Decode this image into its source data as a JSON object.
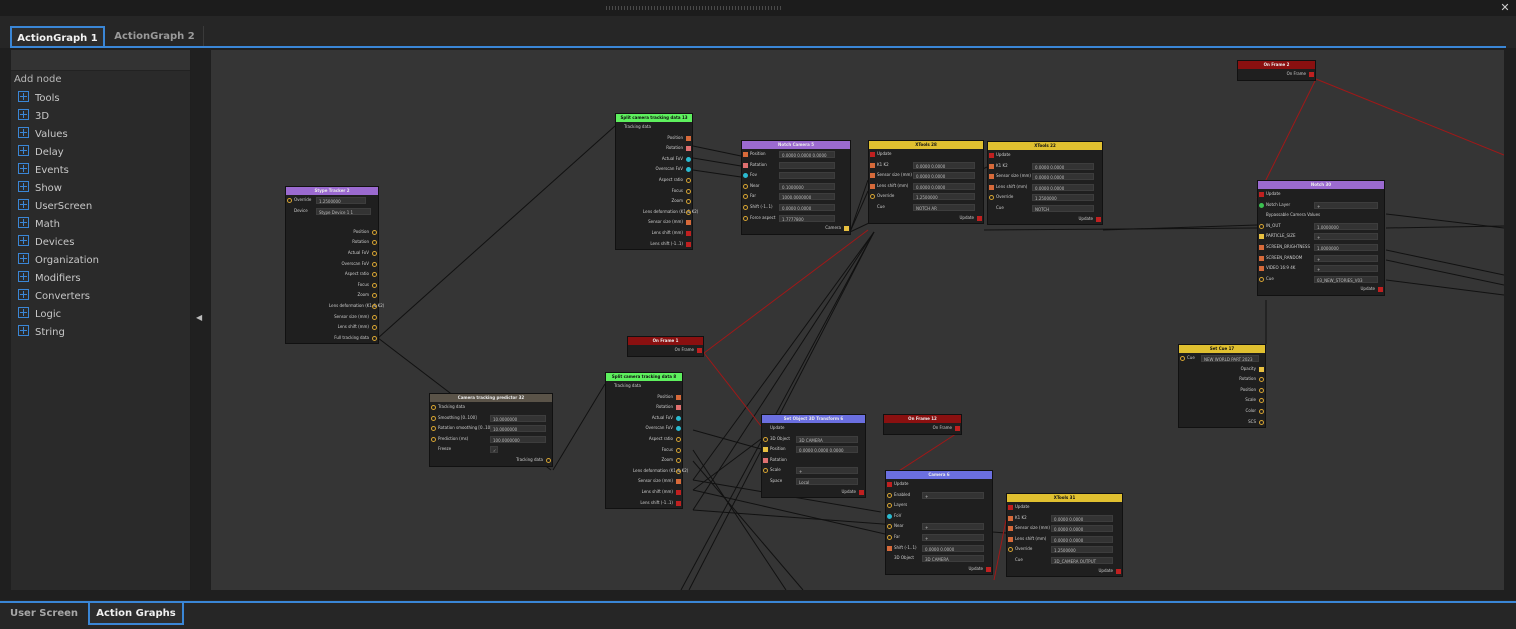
{
  "window": {
    "close_glyph": "✕"
  },
  "tabs": [
    {
      "label": "ActionGraph 1",
      "active": true
    },
    {
      "label": "ActionGraph 2",
      "active": false
    }
  ],
  "sidebar": {
    "heading": "Add node",
    "collapse_glyph": "◀",
    "items": [
      {
        "label": "Tools"
      },
      {
        "label": "3D"
      },
      {
        "label": "Values"
      },
      {
        "label": "Delay"
      },
      {
        "label": "Events"
      },
      {
        "label": "Show"
      },
      {
        "label": "UserScreen"
      },
      {
        "label": "Math"
      },
      {
        "label": "Devices"
      },
      {
        "label": "Organization"
      },
      {
        "label": "Modifiers"
      },
      {
        "label": "Converters"
      },
      {
        "label": "Logic"
      },
      {
        "label": "String"
      }
    ]
  },
  "bottom_tabs": [
    {
      "label": "User Screen",
      "active": false
    },
    {
      "label": "Action Graphs",
      "active": true
    }
  ],
  "colors": {
    "accent": "#3a86d6",
    "canvas": "#353535",
    "wire_black": "#111111",
    "wire_red": "#a01818"
  },
  "nodes": {
    "stype": {
      "title": "Stype Tracker 2",
      "color": "#9b6ad0",
      "override_label": "Override",
      "override_value": "1.2500000",
      "device_label": "Device",
      "device_value": "Stype Device 1 1",
      "outputs": [
        "Position",
        "Rotation",
        "Actual FoV",
        "Overscan FoV",
        "Aspect ratio",
        "Focus",
        "Zoom",
        "Lens deformation (K1 & K2)",
        "Sensor size (mm)",
        "Lens shift (mm)",
        "Full tracking data"
      ]
    },
    "predictor": {
      "title": "Camera tracking predictor 32",
      "color": "#5a5348",
      "in_label": "Tracking data",
      "rows": [
        {
          "label": "Smoothing [0..100]",
          "value": "10.0000000"
        },
        {
          "label": "Rotation smoothing [0..100]",
          "value": "10.0000000"
        },
        {
          "label": "Prediction (ms)",
          "value": "100.0000000"
        }
      ],
      "freeze_label": "Freeze",
      "check": "✓",
      "out_label": "Tracking data"
    },
    "split1": {
      "title": "Split camera tracking data 13",
      "color": "#5ef05e",
      "in_label": "Tracking data",
      "outputs": [
        "Position",
        "Rotation",
        "Actual FoV",
        "Overscan FoV",
        "Aspect ratio",
        "Focus",
        "Zoom",
        "Lens deformation (K1 & K2)",
        "Sensor size (mm)",
        "Lens shift (mm)",
        "Lens shift (-1..1)"
      ]
    },
    "split2": {
      "title": "Split camera tracking data 8",
      "color": "#5ef05e",
      "in_label": "Tracking data",
      "outputs": [
        "Position",
        "Rotation",
        "Actual FoV",
        "Overscan FoV",
        "Aspect ratio",
        "Focus",
        "Zoom",
        "Lens deformation (K1 & K2)",
        "Sensor size (mm)",
        "Lens shift (mm)",
        "Lens shift (-1..1)"
      ]
    },
    "camera5": {
      "title": "Notch Camera 5",
      "color": "#9b6ad0",
      "rows": [
        {
          "label": "Position",
          "value": "0.0000 0.0000 0.0000"
        },
        {
          "label": "Rotation",
          "value": ""
        },
        {
          "label": "Fov",
          "value": ""
        },
        {
          "label": "Near",
          "value": "0.1000000"
        },
        {
          "label": "Far",
          "value": "1000.0000000"
        },
        {
          "label": "Shift (-1..1)",
          "value": "0.0000 0.0000"
        },
        {
          "label": "Force aspect",
          "value": "1.7777800"
        }
      ],
      "out_label": "Camera"
    },
    "xtools28": {
      "title": "XTools 28",
      "color": "#e0c030",
      "in_label": "Update",
      "rows": [
        {
          "label": "K1 K2",
          "value": "0.0000 0.0000"
        },
        {
          "label": "Sensor size (mm)",
          "value": "0.0000 0.0000"
        },
        {
          "label": "Lens shift (mm)",
          "value": "0.0000 0.0000"
        },
        {
          "label": "Override",
          "value": "1.2500000"
        },
        {
          "label": "Cue",
          "value": "NOTCH AR"
        }
      ],
      "out_label": "Update"
    },
    "xtools22": {
      "title": "XTools 22",
      "color": "#e0c030",
      "in_label": "Update",
      "rows": [
        {
          "label": "K1 K2",
          "value": "0.0000 0.0000"
        },
        {
          "label": "Sensor size (mm)",
          "value": "0.0000 0.0000"
        },
        {
          "label": "Lens shift (mm)",
          "value": "0.0000 0.0000"
        },
        {
          "label": "Override",
          "value": "1.2500000"
        },
        {
          "label": "Cue",
          "value": "NOTCH"
        }
      ],
      "out_label": "Update"
    },
    "onframe_top": {
      "title": "On Frame 2",
      "color": "#8a1010",
      "out_label": "On Frame"
    },
    "onframe_mid": {
      "title": "On Frame 1",
      "color": "#8a1010",
      "out_label": "On Frame"
    },
    "onframe_low": {
      "title": "On Frame 12",
      "color": "#8a1010",
      "out_label": "On Frame"
    },
    "notch30": {
      "title": "Notch 30",
      "color": "#9b6ad0",
      "in_label": "Update",
      "rows": [
        {
          "label": "Notch Layer",
          "value": "+"
        },
        {
          "label": "Bypassable Camera Values",
          "value": ""
        },
        {
          "label": "IN_OUT",
          "value": "1.0000000"
        },
        {
          "label": "PARTICLE_SIZE",
          "value": "+"
        },
        {
          "label": "SCREEN_BRIGHTNESS",
          "value": "1.0000000"
        },
        {
          "label": "SCREEN_RANDOM",
          "value": "+"
        },
        {
          "label": "VIDEO 16:9 4K",
          "value": "+"
        },
        {
          "label": "Cue",
          "value": "03_NEW_STORIES_V03"
        }
      ],
      "out_label": "Update"
    },
    "setcue": {
      "title": "Set Cue 17",
      "color": "#e0c030",
      "cue_label": "Cue",
      "cue_value": "NEW WORLD PART 2023",
      "outputs": [
        "Opacity",
        "Rotation",
        "Position",
        "Scale",
        "Color",
        "SCS"
      ]
    },
    "transform": {
      "title": "Set Object 3D Transform 6",
      "color": "#6b6fe0",
      "in_label": "Update",
      "rows": [
        {
          "label": "3D Object",
          "value": "3D CAMERA"
        },
        {
          "label": "Position",
          "value": "0.0000 0.0000 0.0000"
        },
        {
          "label": "Rotation",
          "value": ""
        },
        {
          "label": "Scale",
          "value": "+"
        },
        {
          "label": "Space",
          "value": "Local"
        }
      ],
      "out_label": "Update"
    },
    "camera6": {
      "title": "Camera 6",
      "color": "#6b6fe0",
      "in_label": "Update",
      "rows": [
        {
          "label": "Enabled",
          "value": "+"
        },
        {
          "label": "Layers",
          "value": ""
        },
        {
          "label": "FoV",
          "value": ""
        },
        {
          "label": "Near",
          "value": "+"
        },
        {
          "label": "Far",
          "value": "+"
        },
        {
          "label": "Shift (-1..1)",
          "value": "0.0000 0.0000"
        },
        {
          "label": "3D Object",
          "value": "3D CAMERA"
        }
      ],
      "out_label": "Update"
    },
    "xtools31": {
      "title": "XTools 31",
      "color": "#e0c030",
      "in_label": "Update",
      "rows": [
        {
          "label": "K1 K2",
          "value": "0.0000 0.0000"
        },
        {
          "label": "Sensor size (mm)",
          "value": "0.0000 0.0000"
        },
        {
          "label": "Lens shift (mm)",
          "value": "0.0000 0.0000"
        },
        {
          "label": "Override",
          "value": "1.2500000"
        },
        {
          "label": "Cue",
          "value": "3D_CAMERA OUTPUT"
        }
      ],
      "out_label": "Update"
    }
  }
}
